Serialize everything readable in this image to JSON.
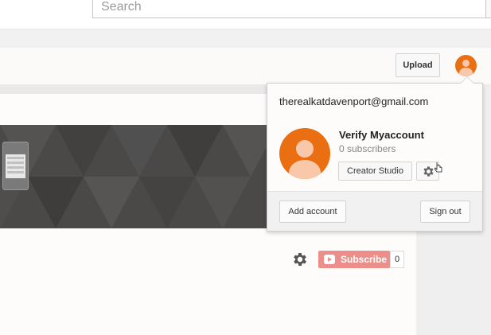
{
  "header": {
    "search": {
      "placeholder": "Search",
      "value": ""
    }
  },
  "toolbar": {
    "upload_label": "Upload"
  },
  "channel": {
    "subscribe_label": "Subscribe",
    "subscriber_count": "0"
  },
  "account_menu": {
    "email": "therealkatdavenport@gmail.com",
    "account_name": "Verify Myaccount",
    "subscribers": "0 subscribers",
    "creator_studio_label": "Creator Studio",
    "add_account_label": "Add account",
    "sign_out_label": "Sign out"
  },
  "icons": [
    "search-icon",
    "avatar",
    "gear-icon",
    "youtube-logo-icon",
    "cursor-icon"
  ],
  "colors": {
    "avatar_orange": "#e96f12",
    "subscribe_red": "#ec8f8a",
    "banner_gray": "#4a4948"
  }
}
